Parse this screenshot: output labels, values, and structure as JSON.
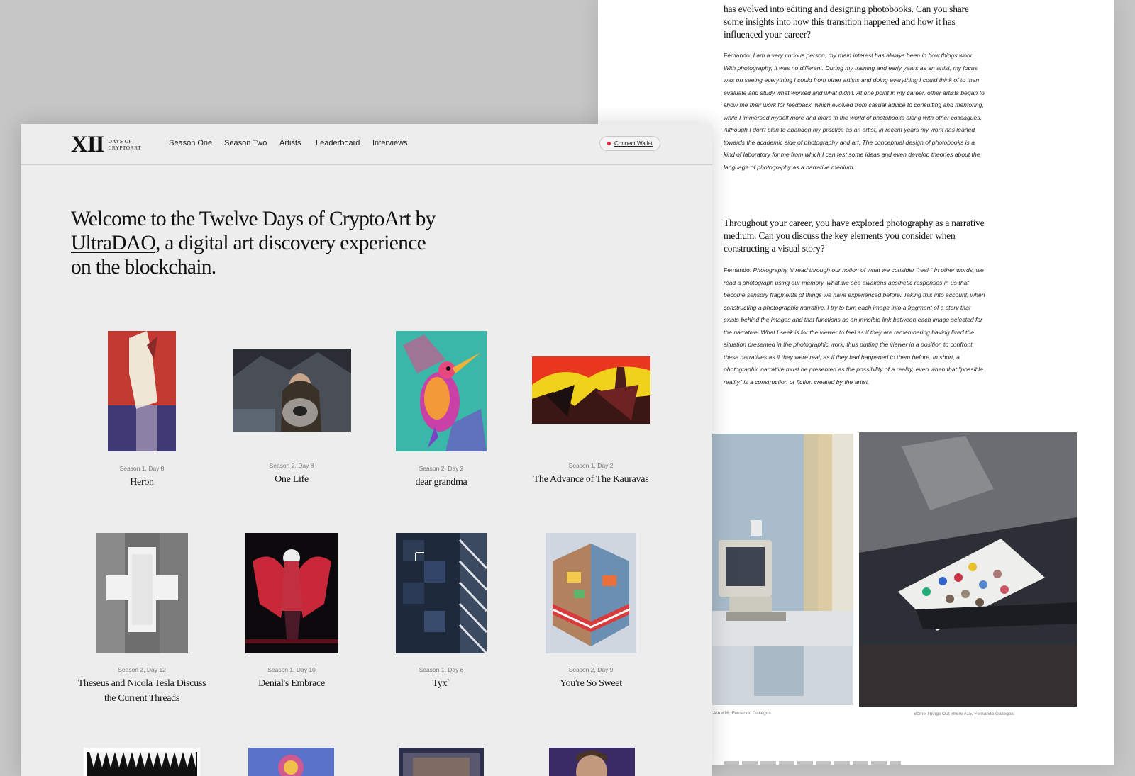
{
  "interview": {
    "q1_partial": "has evolved into editing and designing photobooks. Can you share some insights into how this transition happened and how it has influenced your career?",
    "a1_speaker": "Fernando:",
    "a1_text": "I am a very curious person; my main interest has always been in how things work. With photography, it was no different. During my training and early years as an artist, my focus was on seeing everything I could from other artists and doing everything I could think of to then evaluate and study what worked and what didn't. At one point in my career, other artists began to show me their work for feedback, which evolved from casual advice to consulting and mentoring, while I immersed myself more and more in the world of photobooks along with other colleagues. Although I don't plan to abandon my practice as an artist, in recent years my work has leaned towards the academic side of photography and art. The conceptual design of photobooks is a kind of laboratory for me from which I can test some ideas and even develop theories about the language of photography as a narrative medium.",
    "q2": "Throughout your career, you have explored photography as a narrative medium. Can you discuss the key elements you consider when constructing a visual story?",
    "a2_speaker": "Fernando:",
    "a2_text": "Photography is read through our notion of what we consider \"real.\" In other words, we read a photograph using our memory, what we see awakens aesthetic responses in us that become sensory fragments of things we have experienced before. Taking this into account, when constructing a photographic narrative, I try to turn each image into a fragment of a story that exists behind the images and that functions as an invisible link between each image selected for the narrative. What I seek is for the viewer to feel as if they are remembering having lived the situation presented in the photographic work, thus putting the viewer in a position to confront these narratives as if they were real, as if they had happened to them before. In short, a photographic narrative must be presented as the possibility of a reality, even when that \"possible reality\" is a construction or fiction created by the artist.",
    "caption_left": "A/A #16, Fernando Gallegos.",
    "caption_right": "Some Things Out There #15, Fernando Gallegos."
  },
  "nav": {
    "logo_mark": "XII",
    "logo_line1": "DAYS OF",
    "logo_line2": "CRYPTOART",
    "links": [
      "Season One",
      "Season Two",
      "Artists",
      "Leaderboard",
      "Interviews"
    ],
    "wallet_label": "Connect Wallet"
  },
  "hero": {
    "part1": "Welcome to the Twelve Days of CryptoArt by",
    "link": "UltraDAO",
    "part2": ", a digital art discovery experience on the blockchain."
  },
  "cards": [
    {
      "season": "Season 1, Day 8",
      "title": "Heron"
    },
    {
      "season": "Season 2, Day 8",
      "title": "One Life"
    },
    {
      "season": "Season 2, Day 2",
      "title": "dear grandma"
    },
    {
      "season": "Season 1, Day 2",
      "title": "The Advance of The Kauravas"
    },
    {
      "season": "Season 2, Day 12",
      "title": "Theseus and Nicola Tesla Discuss the Current Threads"
    },
    {
      "season": "Season 1, Day 10",
      "title": "Denial's Embrace"
    },
    {
      "season": "Season 1, Day 6",
      "title": "Tyx`"
    },
    {
      "season": "Season 2, Day 9",
      "title": "You're So Sweet"
    }
  ]
}
